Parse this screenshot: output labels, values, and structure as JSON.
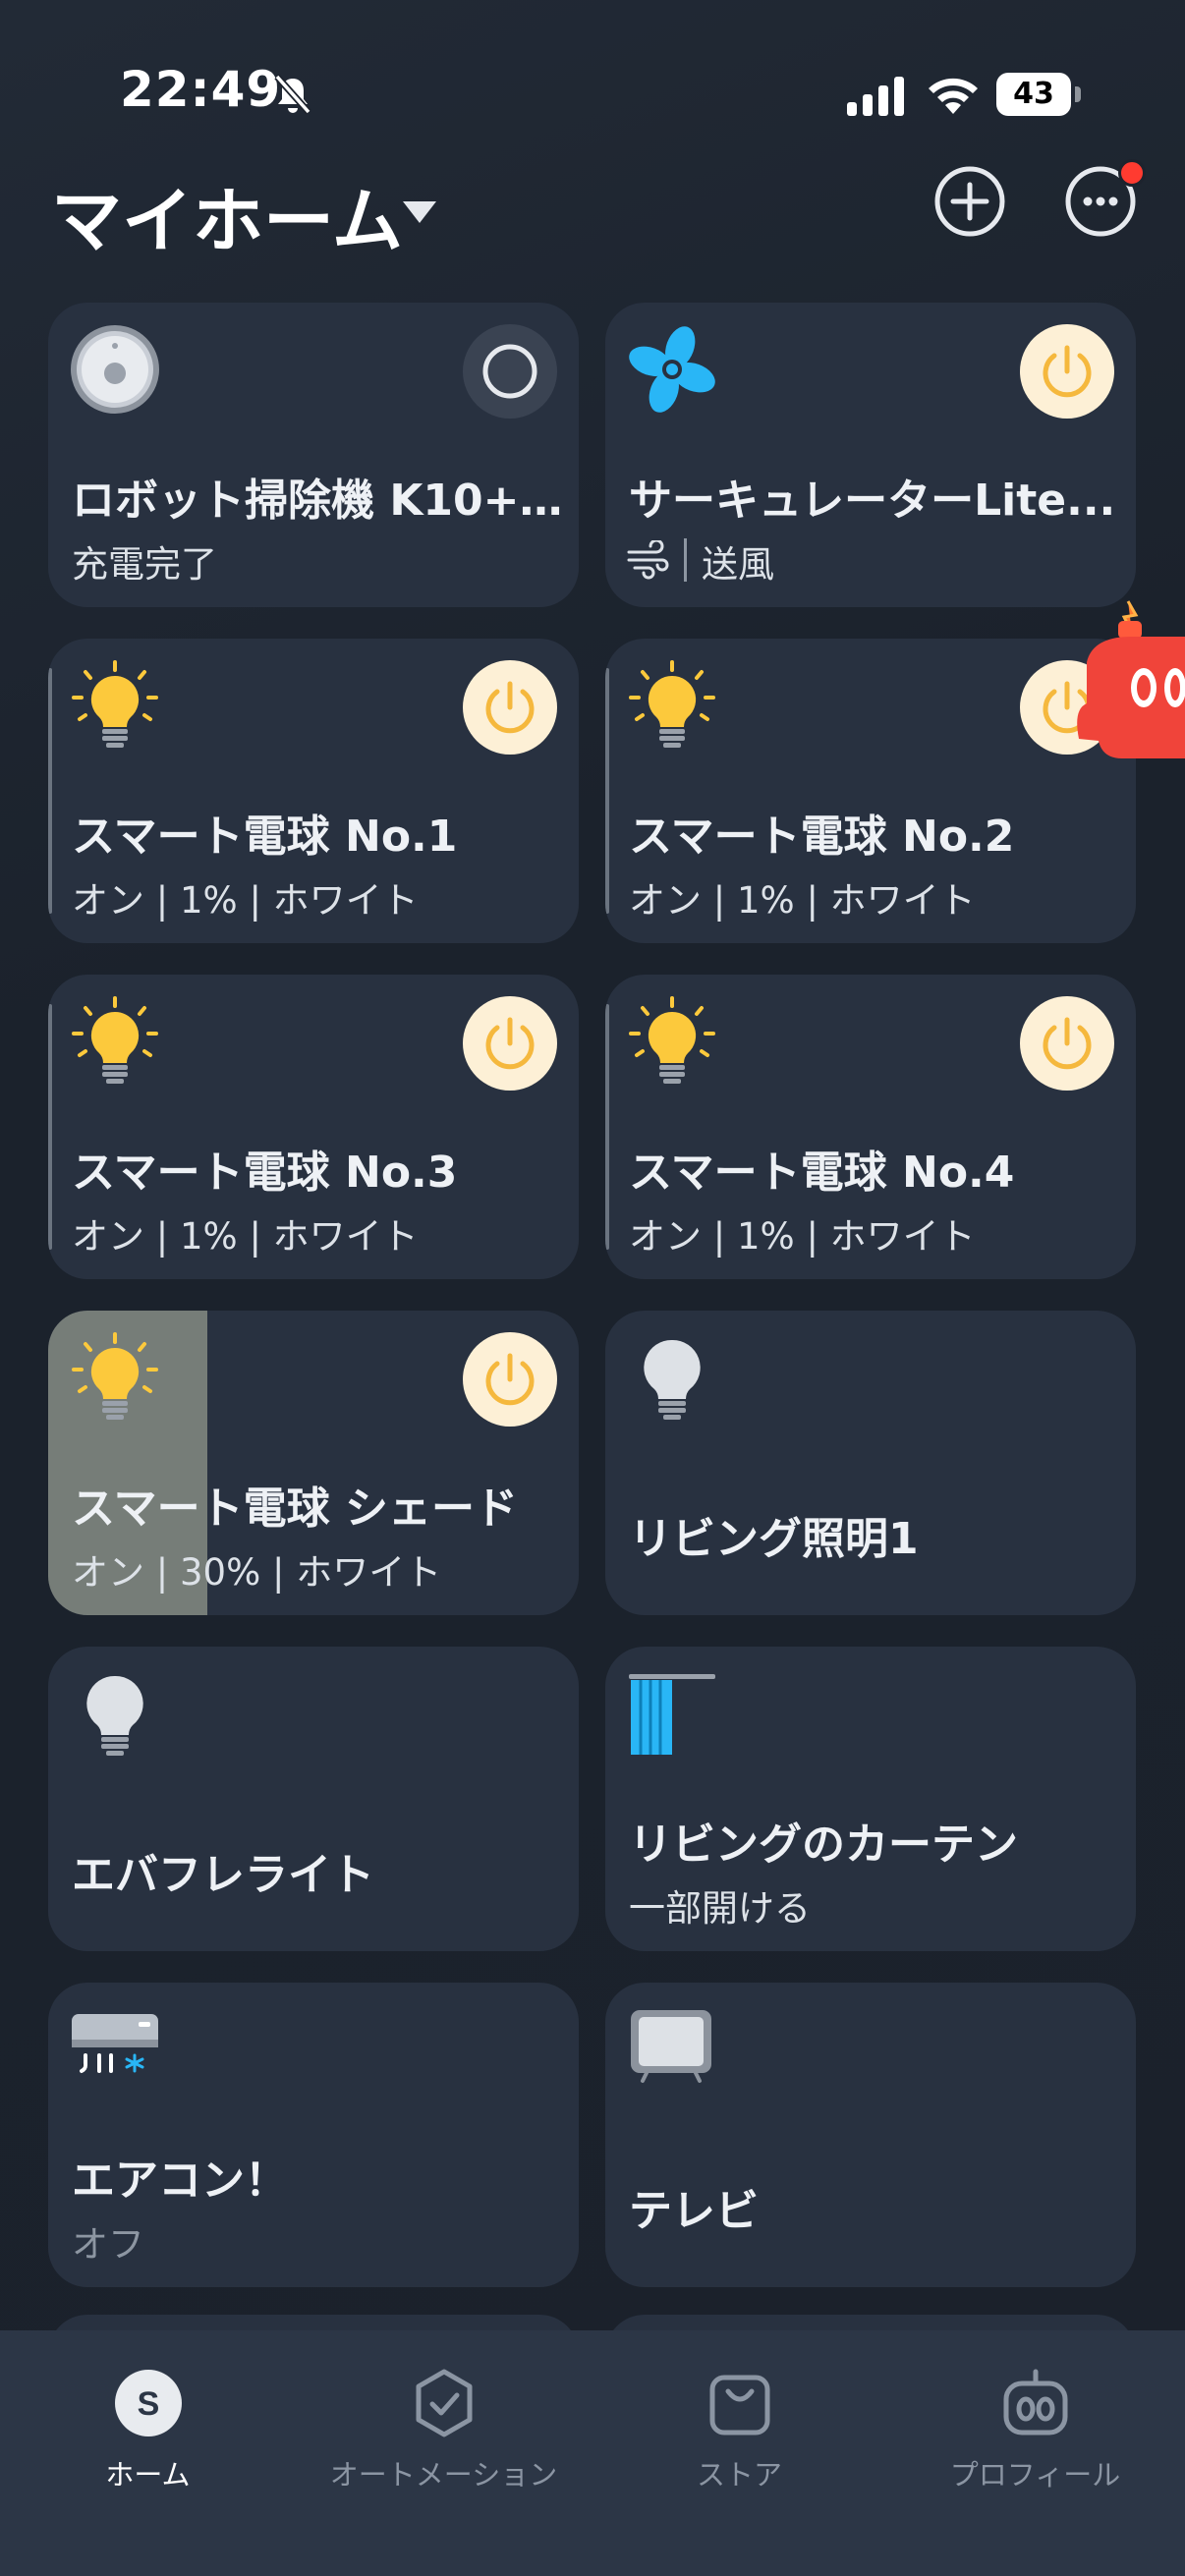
{
  "status_bar": {
    "time": "22:49",
    "battery": "43"
  },
  "header": {
    "home_name": "マイホーム"
  },
  "devices": [
    {
      "name": "ロボット掃除機 K10+/...",
      "status": "充電完了",
      "icon": "robot-vacuum-icon"
    },
    {
      "name": "サーキュレーターLite...",
      "status": "送風",
      "icon": "fan-icon"
    },
    {
      "name": "スマート電球 No.1",
      "status": "オン | 1% | ホワイト",
      "icon": "bulb-icon"
    },
    {
      "name": "スマート電球 No.2",
      "status": "オン | 1% | ホワイト",
      "icon": "bulb-icon"
    },
    {
      "name": "スマート電球 No.3",
      "status": "オン | 1% | ホワイト",
      "icon": "bulb-icon"
    },
    {
      "name": "スマート電球 No.4",
      "status": "オン | 1% | ホワイト",
      "icon": "bulb-icon"
    },
    {
      "name": "スマート電球 シェード",
      "status": "オン | 30% | ホワイト",
      "icon": "bulb-icon",
      "brightness": 0.3
    },
    {
      "name": "リビング照明1",
      "status": "",
      "icon": "bulb-off-icon"
    },
    {
      "name": "エバフレライト",
      "status": "",
      "icon": "bulb-off-icon"
    },
    {
      "name": "リビングのカーテン",
      "status": "一部開ける",
      "icon": "curtain-icon"
    },
    {
      "name": "エアコン！",
      "status": "オフ",
      "icon": "air-conditioner-icon"
    },
    {
      "name": "テレビ",
      "status": "",
      "icon": "tv-icon"
    }
  ],
  "tabs": [
    {
      "label": "ホーム",
      "icon": "home-s-icon",
      "active": true
    },
    {
      "label": "オートメーション",
      "icon": "automation-check-icon",
      "active": false
    },
    {
      "label": "ストア",
      "icon": "store-bag-icon",
      "active": false
    },
    {
      "label": "プロフィール",
      "icon": "profile-robot-icon",
      "active": false
    }
  ],
  "colors": {
    "accent_power": "#f5b83d",
    "power_bg": "#fdf0d6",
    "card_bg": "#283140",
    "badge_red": "#ff3b30",
    "fan_blue": "#29b6f6"
  }
}
